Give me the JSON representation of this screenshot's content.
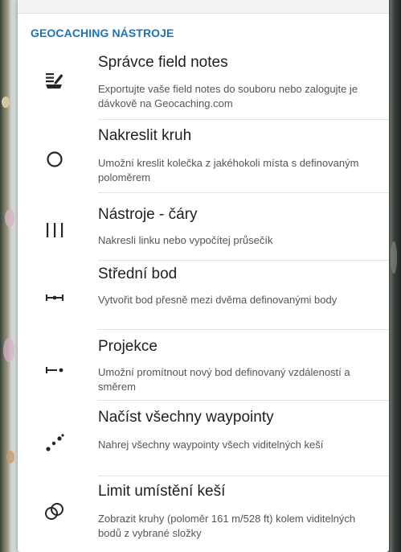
{
  "section": {
    "title": "GEOCACHING NÁSTROJE"
  },
  "items": [
    {
      "icon": "field-notes-icon",
      "title": "Správce field notes",
      "desc": "Exportujte vaše field notes do souboru nebo zalogujte je dávkově na Geocaching.com"
    },
    {
      "icon": "circle-icon",
      "title": "Nakreslit kruh",
      "desc": "Umožní kreslit kolečka z jakéhokoli místa s definovaným poloměrem"
    },
    {
      "icon": "lines-icon",
      "title": "Nástroje - čáry",
      "desc": "Nakresli linku nebo vypočítej průsečík"
    },
    {
      "icon": "midpoint-icon",
      "title": "Střední bod",
      "desc": "Vytvořit bod přesně mezi dvěma definovanými body"
    },
    {
      "icon": "projection-icon",
      "title": "Projekce",
      "desc": "Umožní promítnout nový bod definovaný vzdáleností a směrem"
    },
    {
      "icon": "waypoints-icon",
      "title": "Načíst všechny waypointy",
      "desc": "Nahrej všechny waypointy všech viditelných keší"
    },
    {
      "icon": "cache-limit-icon",
      "title": "Limit umístění keší",
      "desc": "Zobrazit kruhy (poloměr 161 m/528 ft) kolem viditelných bodů z vybrané složky"
    }
  ]
}
